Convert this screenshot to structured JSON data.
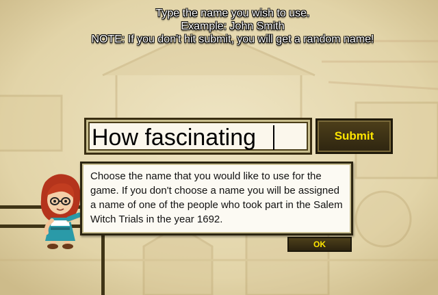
{
  "instructions": {
    "line1": "Type the name you wish to use.",
    "line2": "Example: John Smith",
    "line3": "NOTE: If you don't hit submit, you will get a random name!"
  },
  "name_input": {
    "value": "How fascinating"
  },
  "submit_button": {
    "label": "Submit"
  },
  "dialog": {
    "text": "Choose the name that you would like to use for the game. If you don't choose a name you will be assigned a name of one of the people who took part in the Salem Witch Trials in the year 1692.",
    "ok_label": "OK"
  },
  "character": {
    "icon": "red-haired-girl-with-glasses-icon"
  },
  "colors": {
    "button_text": "#ffe600",
    "button_bg": "#3b3015",
    "background": "#e8dcb6"
  }
}
